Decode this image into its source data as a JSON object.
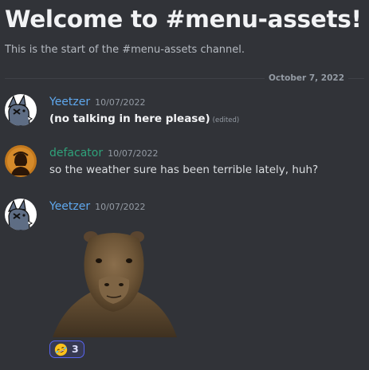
{
  "channel": {
    "welcome_title": "Welcome to #menu-assets!",
    "welcome_subtitle": "This is the start of the #menu-assets channel."
  },
  "divider": {
    "date": "October 7, 2022"
  },
  "messages": [
    {
      "author": "Yeetzer",
      "author_color": "#5fa8ee",
      "timestamp": "10/07/2022",
      "text": "(no talking in here please)",
      "edited_label": "(edited)"
    },
    {
      "author": "defacator",
      "author_color": "#2fa27a",
      "timestamp": "10/07/2022",
      "text": "so the weather sure has been terrible lately, huh?"
    },
    {
      "author": "Yeetzer",
      "author_color": "#5fa8ee",
      "timestamp": "10/07/2022",
      "attachment": "capybara-image",
      "reaction": {
        "emoji": "rolling-on-floor-laughing-icon",
        "count": "3"
      }
    }
  ],
  "colors": {
    "background": "#313338",
    "reaction_border": "#5865f2",
    "reaction_bg": "#373a53"
  }
}
